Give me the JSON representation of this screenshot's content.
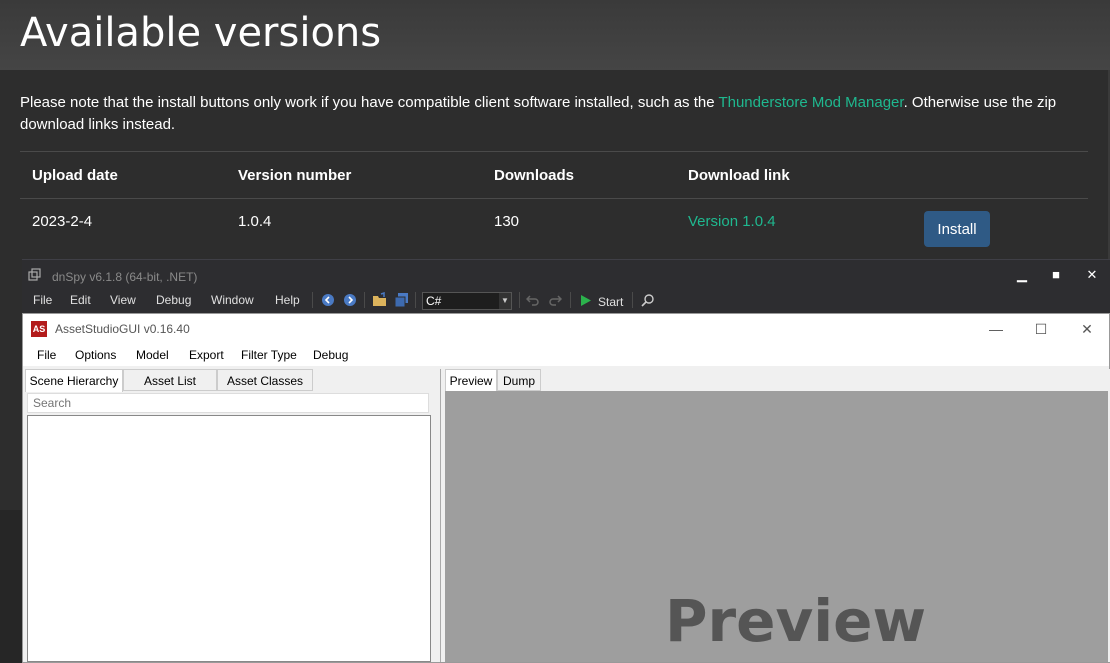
{
  "web": {
    "title": "Available versions",
    "note_before": "Please note that the install buttons only work if you have compatible client software installed, such as the ",
    "note_link": "Thunderstore Mod Manager",
    "note_after": ". Otherwise use the zip download links instead.",
    "table": {
      "headers": [
        "Upload date",
        "Version number",
        "Downloads",
        "Download link"
      ],
      "rows": [
        {
          "upload_date": "2023-2-4",
          "version": "1.0.4",
          "downloads": "130",
          "link": "Version 1.0.4",
          "install": "Install"
        }
      ]
    },
    "colors": {
      "link": "#1fb88f",
      "button": "#2f5a85"
    }
  },
  "dnspy": {
    "title": "dnSpy v6.1.8 (64-bit, .NET)",
    "menus": [
      "File",
      "Edit",
      "View",
      "Debug",
      "Window",
      "Help"
    ],
    "language": "C#",
    "start_label": "Start",
    "controls": {
      "minimize": "▁",
      "maximize": "■",
      "close": "✕"
    }
  },
  "assetstudio": {
    "logo": "AS",
    "title": "AssetStudioGUI v0.16.40",
    "menus": [
      "File",
      "Options",
      "Model",
      "Export",
      "Filter Type",
      "Debug"
    ],
    "left_tabs": [
      "Scene Hierarchy",
      "Asset List",
      "Asset Classes"
    ],
    "search_placeholder": "Search",
    "right_tabs": [
      "Preview",
      "Dump"
    ],
    "preview_text": "Preview",
    "controls": {
      "minimize": "—",
      "maximize": "☐",
      "close": "✕"
    }
  }
}
